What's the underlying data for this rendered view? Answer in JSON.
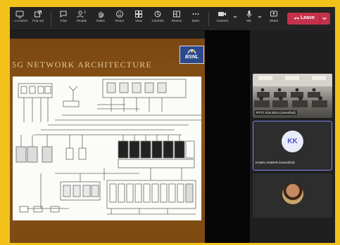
{
  "toolbar": {
    "items": [
      {
        "label": "...n control",
        "icon": "screen-control-icon"
      },
      {
        "label": "Pop out",
        "icon": "pop-out-icon"
      },
      {
        "label": "Chat",
        "icon": "chat-icon"
      },
      {
        "label": "People",
        "icon": "people-icon",
        "badge": "3"
      },
      {
        "label": "Raise",
        "icon": "raise-hand-icon"
      },
      {
        "label": "React",
        "icon": "react-icon"
      },
      {
        "label": "View",
        "icon": "view-icon"
      },
      {
        "label": "Controls",
        "icon": "controls-icon"
      },
      {
        "label": "Rooms",
        "icon": "rooms-icon"
      },
      {
        "label": "More",
        "icon": "more-icon"
      },
      {
        "label": "Camera",
        "icon": "camera-icon"
      },
      {
        "label": "Mic",
        "icon": "mic-icon"
      },
      {
        "label": "Share",
        "icon": "share-icon"
      }
    ],
    "leave_label": "Leave",
    "colors": {
      "leave_bg": "#c4314b"
    }
  },
  "slide": {
    "title": "5G NETWORK ARCHITECTURE",
    "logo_text": "BSNL"
  },
  "participants": [
    {
      "name": "RTTC ICM 2024 (Unverified)",
      "type": "room-video"
    },
    {
      "name": "KAMAL KUMAR (Unverified)",
      "initials": "KK",
      "type": "avatar",
      "active_speaker": true
    },
    {
      "name": "",
      "type": "photo-avatar"
    }
  ],
  "colors": {
    "accent": "#7f85f5",
    "page_frame": "#f2c21a"
  }
}
